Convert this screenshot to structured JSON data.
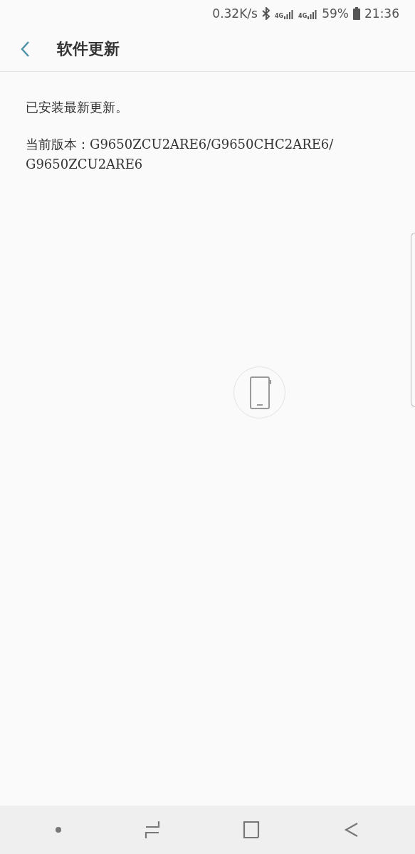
{
  "status_bar": {
    "speed": "0.32K/s",
    "network_labels": [
      "4G",
      "4G"
    ],
    "battery": "59%",
    "time": "21:36"
  },
  "header": {
    "title": "软件更新"
  },
  "content": {
    "message": "已安装最新更新。",
    "version": "当前版本：G9650ZCU2ARE6/G9650CHC2ARE6/\nG9650ZCU2ARE6"
  }
}
